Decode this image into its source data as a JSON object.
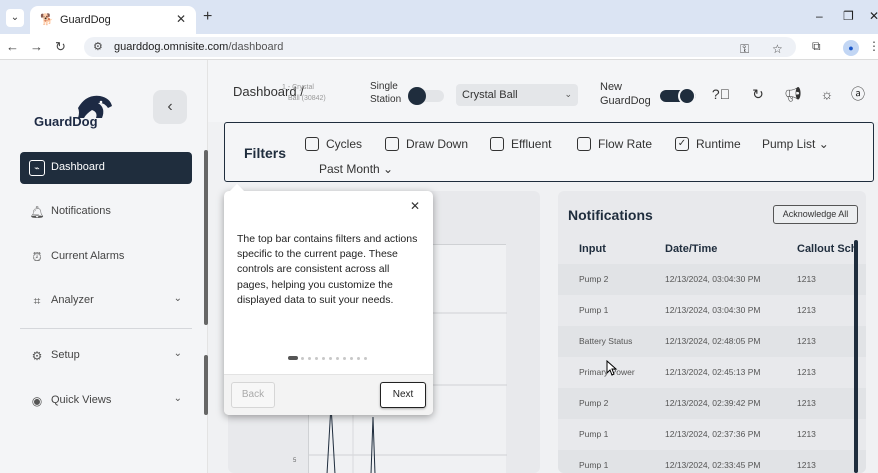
{
  "browser": {
    "tab_title": "GuardDog",
    "url_host": "guarddog.omnisite.com",
    "url_path": "/dashboard"
  },
  "sidebar": {
    "logo_text": "GuardDog",
    "items": [
      {
        "label": "Dashboard",
        "icon": "pulse-icon",
        "active": true
      },
      {
        "label": "Notifications",
        "icon": "bell-icon"
      },
      {
        "label": "Current Alarms",
        "icon": "alarm-clock-icon"
      },
      {
        "label": "Analyzer",
        "icon": "analyzer-icon",
        "expandable": true
      },
      {
        "label": "Setup",
        "icon": "gear-icon",
        "expandable": true
      },
      {
        "label": "Quick Views",
        "icon": "eye-icon",
        "expandable": true
      }
    ]
  },
  "header": {
    "breadcrumb": "Dashboard /",
    "breadcrumb_sub_line1": "1 - Crystal",
    "breadcrumb_sub_line2": "Ball (30842)",
    "single_station_line1": "Single",
    "single_station_line2": "Station",
    "station_value": "Crystal Ball",
    "new_guarddog_line1": "New",
    "new_guarddog_line2": "GuardDog"
  },
  "filters": {
    "title": "Filters",
    "options": [
      {
        "label": "Cycles",
        "checked": false
      },
      {
        "label": "Draw Down",
        "checked": false
      },
      {
        "label": "Effluent",
        "checked": false
      },
      {
        "label": "Flow Rate",
        "checked": false
      },
      {
        "label": "Runtime",
        "checked": true
      }
    ],
    "pump_list": "Pump List",
    "period": "Past Month"
  },
  "chart": {
    "tick_label": "5"
  },
  "notifications": {
    "title": "Notifications",
    "ack_button": "Acknowledge All",
    "columns": [
      "Input",
      "Date/Time",
      "Callout Sch"
    ],
    "rows": [
      [
        "Pump 2",
        "12/13/2024, 03:04:30 PM",
        "1213"
      ],
      [
        "Pump 1",
        "12/13/2024, 03:04:30 PM",
        "1213"
      ],
      [
        "Battery Status",
        "12/13/2024, 02:48:05 PM",
        "1213"
      ],
      [
        "Primary Power",
        "12/13/2024, 02:45:13 PM",
        "1213"
      ],
      [
        "Pump 2",
        "12/13/2024, 02:39:42 PM",
        "1213"
      ],
      [
        "Pump 1",
        "12/13/2024, 02:37:36 PM",
        "1213"
      ],
      [
        "Pump 1",
        "12/13/2024, 02:33:45 PM",
        "1213"
      ]
    ]
  },
  "tour": {
    "text": "The top bar contains filters and actions specific to the current page. These controls are consistent across all pages, helping you customize the displayed data to suit your needs.",
    "back_label": "Back",
    "next_label": "Next",
    "step": 1,
    "total_steps": 11
  },
  "colors": {
    "brand_dark": "#1f2d3d",
    "tabstrip": "#dbe4f3"
  }
}
